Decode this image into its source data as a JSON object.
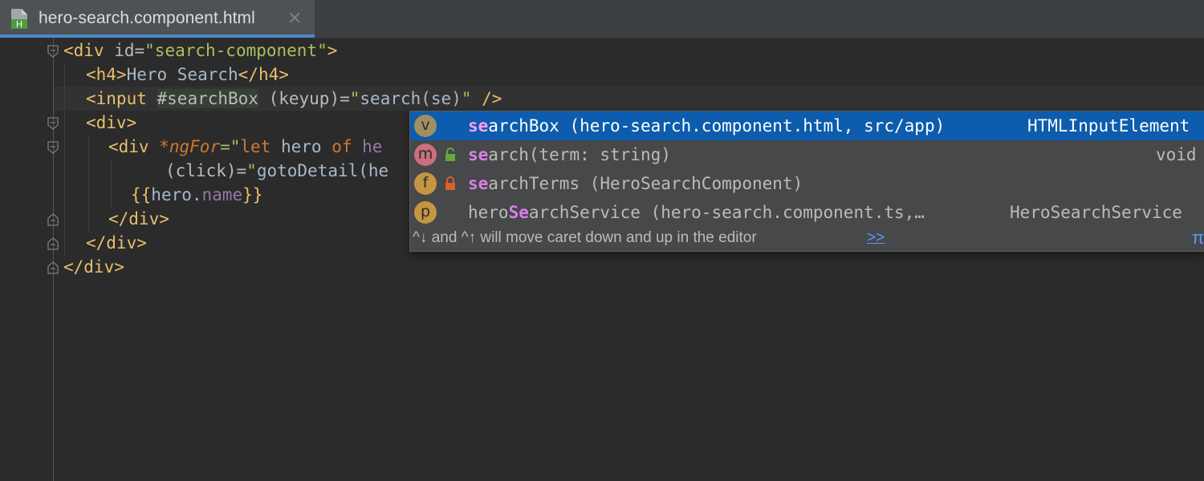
{
  "tab": {
    "file_name": "hero-search.component.html",
    "close_glyph": "✕",
    "icon": "html-file-icon",
    "icon_letter": "H"
  },
  "code_lines": {
    "l1": {
      "open": "<div",
      "attr": " id=",
      "value": "\"search-component\"",
      "close": ">"
    },
    "l2": {
      "open": "<h4>",
      "text": "Hero Search",
      "close": "</h4>"
    },
    "l3": {
      "open": "<input",
      "ref": "#searchBox",
      "attr": " (keyup)=",
      "q1": "\"",
      "call": "search(se)",
      "q2": "\"",
      "close": " />"
    },
    "l4": {
      "open": "<div>"
    },
    "l5": {
      "open": "<div",
      "directive": "*ngFor",
      "eq": "=\"",
      "kw": "let",
      "rest": " hero ",
      "kw2": "of",
      "tail": " he"
    },
    "l6": {
      "attr": "(click)=",
      "q": "\"",
      "call": "gotoDetail(he"
    },
    "l7": {
      "open_brace": "{{",
      "obj": "hero.",
      "prop": "name",
      "close_brace": "}}"
    },
    "l8": {
      "close": "</div>"
    },
    "l9": {
      "close": "</div>"
    },
    "l10": {
      "close": "</div>"
    }
  },
  "completion": {
    "items": [
      {
        "kind": "v",
        "match": "se",
        "rest": "archBox (hero-search.component.html, src/app)",
        "type": "HTMLInputElement",
        "color": "#a08f5f",
        "visibility": ""
      },
      {
        "kind": "m",
        "match": "se",
        "rest": "arch(term: string)",
        "type": "void",
        "color": "#c96f7d",
        "visibility": "public"
      },
      {
        "kind": "f",
        "match": "se",
        "rest": "archTerms (HeroSearchComponent)",
        "type": "",
        "color": "#c59543",
        "visibility": "private"
      },
      {
        "kind": "p",
        "prefix": "hero",
        "match": "Se",
        "rest": "archService (hero-search.component.ts,…",
        "type": "HeroSearchService",
        "color": "#c59543",
        "visibility": ""
      }
    ],
    "hint": "^↓ and ^↑ will move caret down and up in the editor",
    "hint_link": ">>",
    "pi": "π"
  },
  "colors": {
    "selection": "#0d5cad",
    "match_highlight": "#d87fe8",
    "tag": "#e8bf6a",
    "string": "#a5c25c",
    "keyword": "#cc7832"
  }
}
